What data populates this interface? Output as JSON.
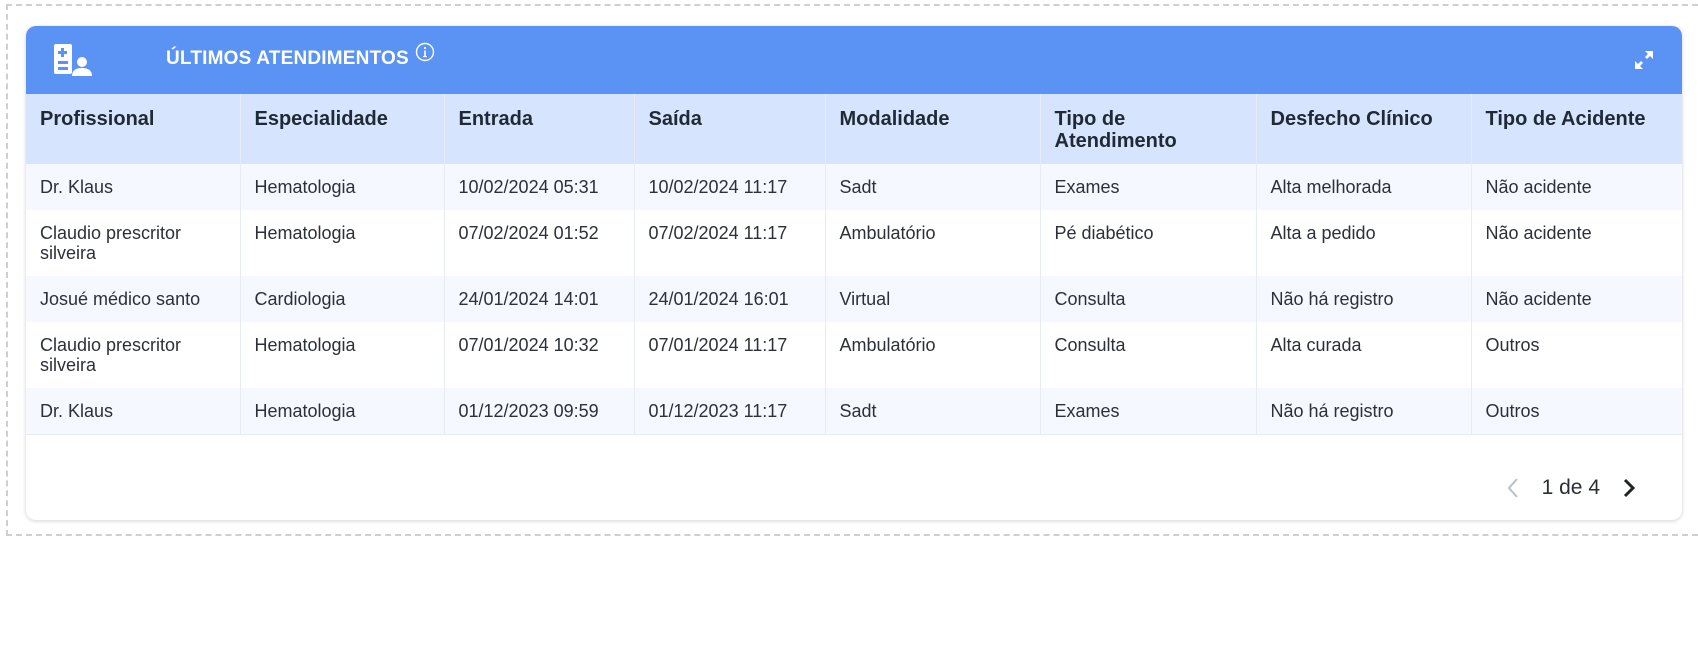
{
  "panel": {
    "title": "ÚLTIMOS ATENDIMENTOS",
    "icon": "medical-report-person-icon",
    "info_icon": "info-circle-icon",
    "expand_icon": "expand-arrows-icon",
    "header_color": "#5b93f5"
  },
  "table": {
    "columns": [
      "Profissional",
      "Especialidade",
      "Entrada",
      "Saída",
      "Modalidade",
      "Tipo de Atendimento",
      "Desfecho Clínico",
      "Tipo de Acidente"
    ],
    "rows": [
      [
        "Dr. Klaus",
        "Hematologia",
        "10/02/2024 05:31",
        "10/02/2024 11:17",
        "Sadt",
        "Exames",
        "Alta melhorada",
        "Não acidente"
      ],
      [
        "Claudio prescritor silveira",
        "Hematologia",
        "07/02/2024 01:52",
        "07/02/2024 11:17",
        "Ambulatório",
        "Pé diabético",
        "Alta a pedido",
        "Não acidente"
      ],
      [
        "Josué médico santo",
        "Cardiologia",
        "24/01/2024 14:01",
        "24/01/2024 16:01",
        "Virtual",
        "Consulta",
        "Não há registro",
        "Não acidente"
      ],
      [
        "Claudio prescritor silveira",
        "Hematologia",
        "07/01/2024 10:32",
        "07/01/2024 11:17",
        "Ambulatório",
        "Consulta",
        "Alta curada",
        "Outros"
      ],
      [
        "Dr. Klaus",
        "Hematologia",
        "01/12/2023 09:59",
        "01/12/2023 11:17",
        "Sadt",
        "Exames",
        "Não há registro",
        "Outros"
      ]
    ]
  },
  "pagination": {
    "label": "1 de 4",
    "prev_icon": "chevron-left-icon",
    "next_icon": "chevron-right-icon"
  }
}
